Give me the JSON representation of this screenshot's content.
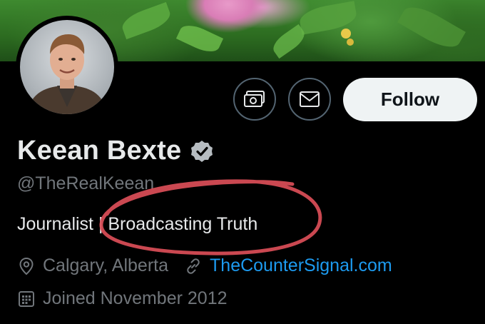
{
  "profile": {
    "name": "Keean Bexte",
    "handle": "@TheRealKeean",
    "bio": "Journalist | Broadcasting Truth",
    "location": "Calgary, Alberta",
    "website": "TheCounterSignal.com",
    "joined": "Joined November 2012"
  },
  "actions": {
    "follow_label": "Follow"
  },
  "icons": {
    "verified": "verified-badge-icon",
    "more_actions": "money-icon",
    "message": "envelope-icon",
    "location": "location-pin-icon",
    "link": "link-icon",
    "calendar": "calendar-icon"
  },
  "colors": {
    "background": "#000000",
    "text_primary": "#e7e9ea",
    "text_secondary": "#71767b",
    "link": "#1d9bf0",
    "follow_bg": "#eff3f4",
    "annotation": "#e0505a"
  }
}
